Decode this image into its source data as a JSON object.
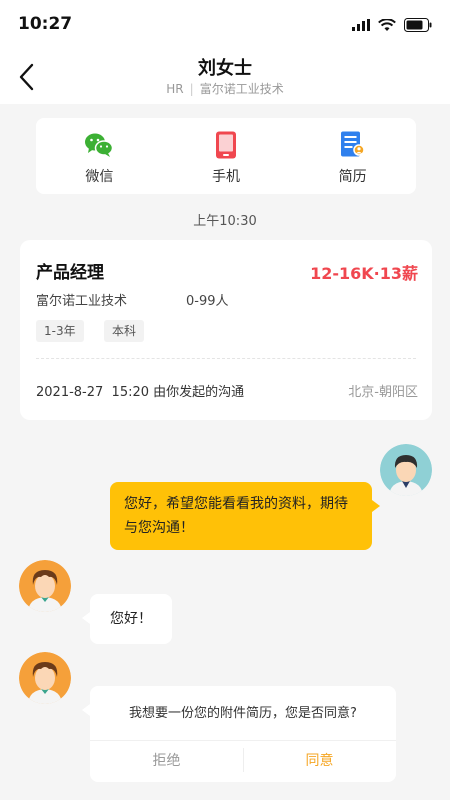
{
  "status": {
    "time": "10:27"
  },
  "header": {
    "title": "刘女士",
    "role": "HR",
    "company": "富尔诺工业技术"
  },
  "actions": [
    {
      "label": "微信",
      "icon": "wechat-icon",
      "color": "#3cb034"
    },
    {
      "label": "手机",
      "icon": "phone-icon",
      "color": "#f0474f"
    },
    {
      "label": "简历",
      "icon": "resume-icon",
      "color": "#2f80ed"
    }
  ],
  "time_label": "上午10:30",
  "job": {
    "title": "产品经理",
    "salary": "12-16K·13薪",
    "company": "富尔诺工业技术",
    "size": "0-99人",
    "tags": [
      "1-3年",
      "本科"
    ],
    "date_text": "2021-8-27  15:20 由你发起的沟通",
    "location": "北京-朝阳区"
  },
  "messages": {
    "outgoing": "您好，希望您能看看我的资料，期待与您沟通！",
    "incoming": "您好！",
    "request": "我想要一份您的附件简历，您是否同意?",
    "reject": "拒绝",
    "accept": "同意"
  },
  "colors": {
    "accent": "#ffc107",
    "salary": "#f0474f",
    "accept": "#f5a623"
  }
}
